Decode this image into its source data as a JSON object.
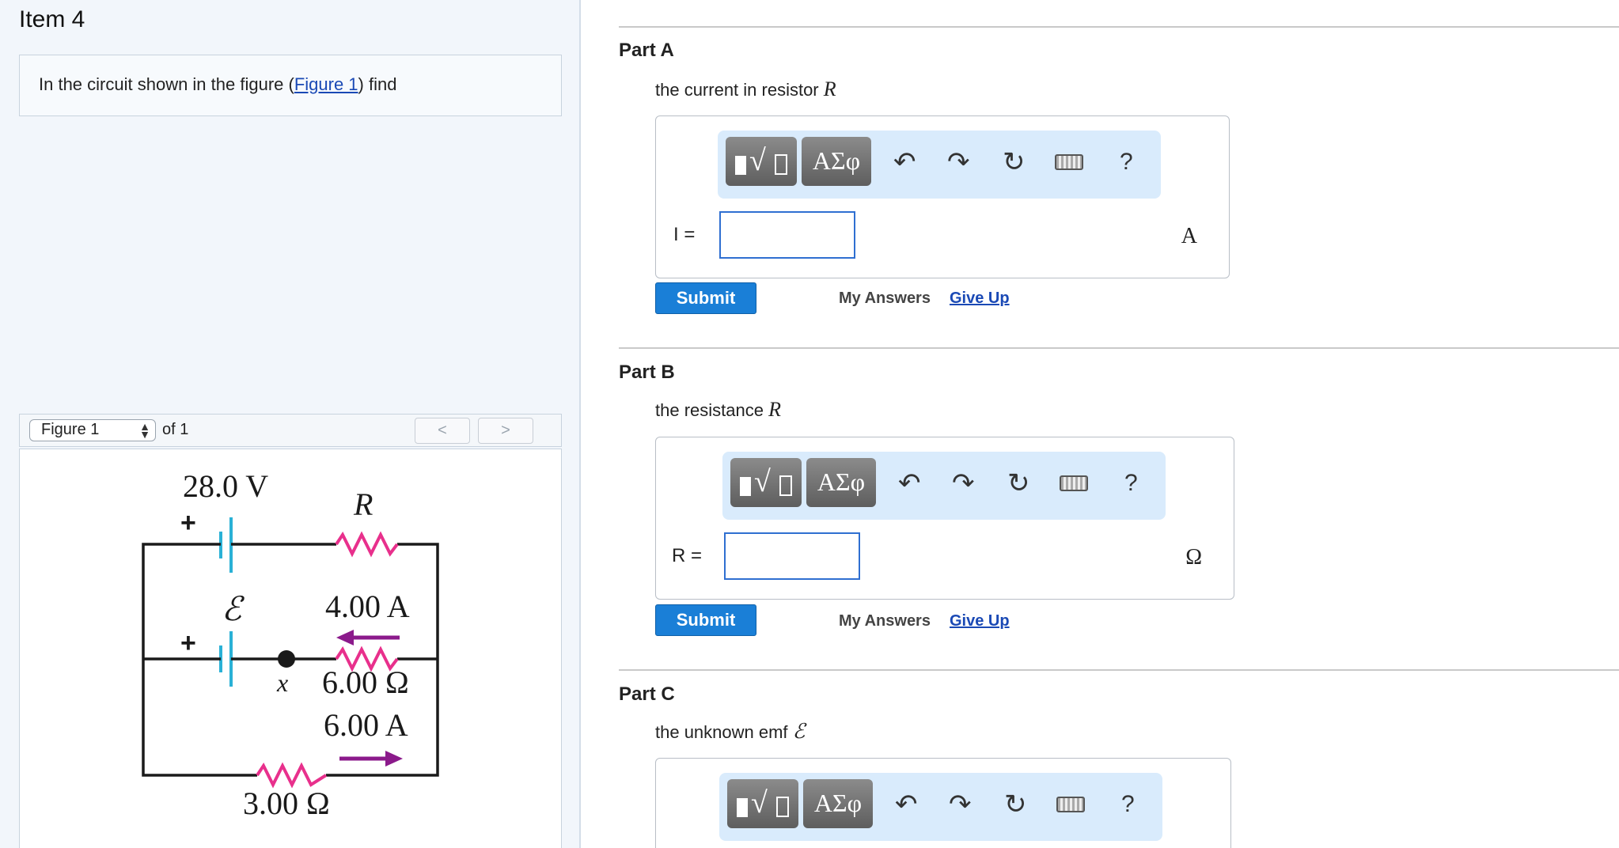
{
  "item": {
    "title": "Item 4"
  },
  "question": {
    "text_before": "In the circuit shown in the figure (",
    "figure_link": "Figure 1",
    "text_after": ") find"
  },
  "figure_nav": {
    "selected": "Figure 1",
    "of_text": "of 1",
    "prev_label": "<",
    "next_label": ">"
  },
  "figure": {
    "battery_top_label": "28.0 V",
    "resistor_r_label": "R",
    "plus_sign": "+",
    "emf_symbol": "ℰ",
    "current_mid_label": "4.00 A",
    "point_label": "x",
    "resistor_mid_label": "6.00 Ω",
    "current_bottom_label": "6.00 A",
    "resistor_bottom_label": "3.00 Ω",
    "colors": {
      "battery": "#2ab1d6",
      "resistor": "#e8308c",
      "arrow": "#8b1a8b",
      "wire": "#1a1a1a"
    }
  },
  "toolbar": {
    "greek_label": "ΑΣφ",
    "undo_icon": "↶",
    "redo_icon": "↷",
    "reset_icon": "↻",
    "help_label": "?"
  },
  "parts": [
    {
      "title": "Part A",
      "prompt": "the current in resistor ",
      "prompt_var": "R",
      "answer_label": "I =",
      "unit": "A",
      "submit": "Submit",
      "my_answers": "My Answers",
      "give_up": "Give Up"
    },
    {
      "title": "Part B",
      "prompt": "the resistance ",
      "prompt_var": "R",
      "answer_label": "R =",
      "unit": "Ω",
      "submit": "Submit",
      "my_answers": "My Answers",
      "give_up": "Give Up"
    },
    {
      "title": "Part C",
      "prompt": "the unknown emf ",
      "prompt_var": "ℰ"
    }
  ]
}
